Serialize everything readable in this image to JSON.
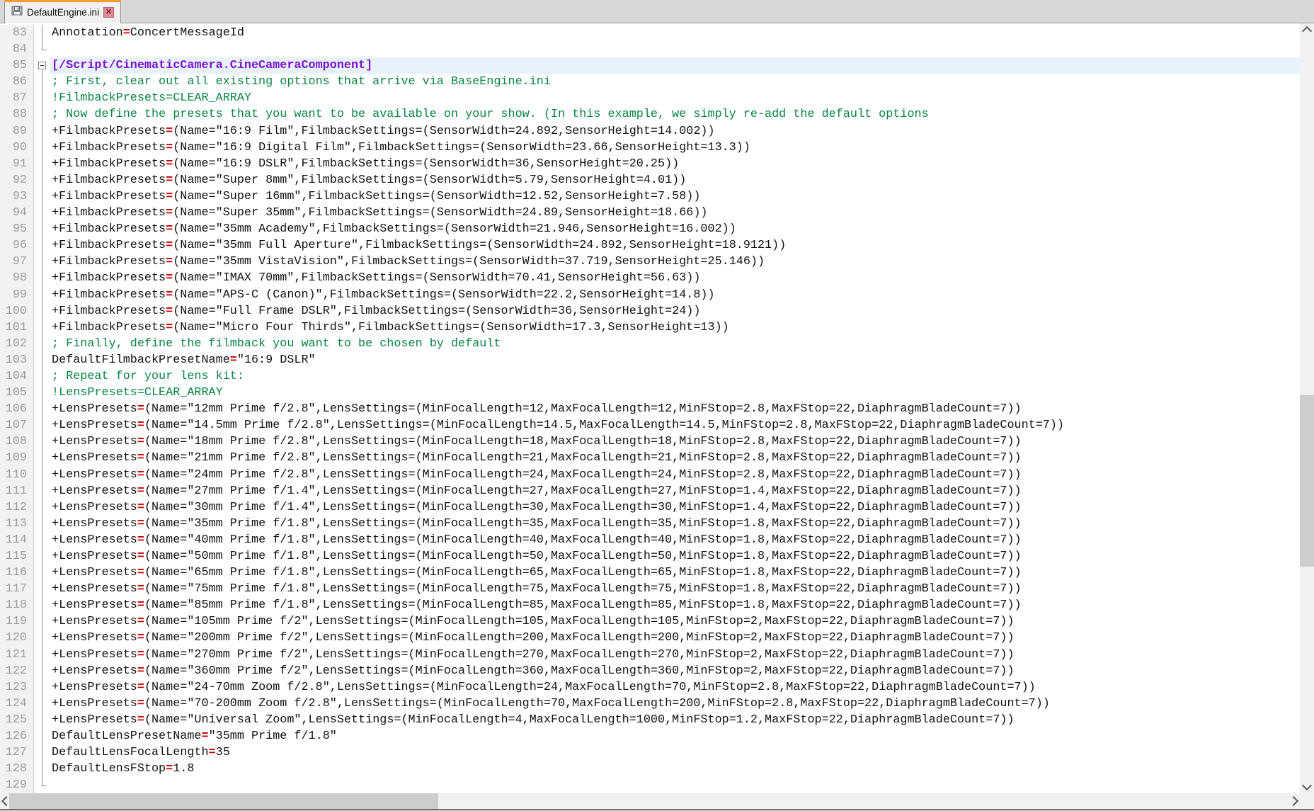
{
  "tab": {
    "title": "DefaultEngine.ini",
    "close_glyph": "✕",
    "save_icon": "floppy-disk-icon"
  },
  "editor": {
    "colors": {
      "text": "#121212",
      "assign": "#c40000",
      "comment": "#078542",
      "clearline": "#078542",
      "section": "#7a11d0",
      "linenum": "#9c9c9c",
      "currentline": "#e8f2fc"
    },
    "lines": [
      {
        "n": 83,
        "fold": "line",
        "type": "kv",
        "key": "Annotation",
        "eq": "=",
        "rest": "ConcertMessageId"
      },
      {
        "n": 84,
        "fold": "end",
        "type": "empty"
      },
      {
        "n": 85,
        "fold": "box",
        "type": "section",
        "current": true,
        "text": "[/Script/CinematicCamera.CineCameraComponent]"
      },
      {
        "n": 86,
        "fold": "line",
        "type": "comment",
        "text": "; First, clear out all existing options that arrive via BaseEngine.ini"
      },
      {
        "n": 87,
        "fold": "line",
        "type": "clear",
        "text": "!FilmbackPresets=CLEAR_ARRAY"
      },
      {
        "n": 88,
        "fold": "line",
        "type": "comment",
        "text": "; Now define the presets that you want to be available on your show. (In this example, we simply re-add the default options"
      },
      {
        "n": 89,
        "fold": "line",
        "type": "kv",
        "key": "+FilmbackPresets",
        "eq": "=",
        "rest": "(Name=\"16:9 Film\",FilmbackSettings=(SensorWidth=24.892,SensorHeight=14.002))"
      },
      {
        "n": 90,
        "fold": "line",
        "type": "kv",
        "key": "+FilmbackPresets",
        "eq": "=",
        "rest": "(Name=\"16:9 Digital Film\",FilmbackSettings=(SensorWidth=23.66,SensorHeight=13.3))"
      },
      {
        "n": 91,
        "fold": "line",
        "type": "kv",
        "key": "+FilmbackPresets",
        "eq": "=",
        "rest": "(Name=\"16:9 DSLR\",FilmbackSettings=(SensorWidth=36,SensorHeight=20.25))"
      },
      {
        "n": 92,
        "fold": "line",
        "type": "kv",
        "key": "+FilmbackPresets",
        "eq": "=",
        "rest": "(Name=\"Super 8mm\",FilmbackSettings=(SensorWidth=5.79,SensorHeight=4.01))"
      },
      {
        "n": 93,
        "fold": "line",
        "type": "kv",
        "key": "+FilmbackPresets",
        "eq": "=",
        "rest": "(Name=\"Super 16mm\",FilmbackSettings=(SensorWidth=12.52,SensorHeight=7.58))"
      },
      {
        "n": 94,
        "fold": "line",
        "type": "kv",
        "key": "+FilmbackPresets",
        "eq": "=",
        "rest": "(Name=\"Super 35mm\",FilmbackSettings=(SensorWidth=24.89,SensorHeight=18.66))"
      },
      {
        "n": 95,
        "fold": "line",
        "type": "kv",
        "key": "+FilmbackPresets",
        "eq": "=",
        "rest": "(Name=\"35mm Academy\",FilmbackSettings=(SensorWidth=21.946,SensorHeight=16.002))"
      },
      {
        "n": 96,
        "fold": "line",
        "type": "kv",
        "key": "+FilmbackPresets",
        "eq": "=",
        "rest": "(Name=\"35mm Full Aperture\",FilmbackSettings=(SensorWidth=24.892,SensorHeight=18.9121))"
      },
      {
        "n": 97,
        "fold": "line",
        "type": "kv",
        "key": "+FilmbackPresets",
        "eq": "=",
        "rest": "(Name=\"35mm VistaVision\",FilmbackSettings=(SensorWidth=37.719,SensorHeight=25.146))"
      },
      {
        "n": 98,
        "fold": "line",
        "type": "kv",
        "key": "+FilmbackPresets",
        "eq": "=",
        "rest": "(Name=\"IMAX 70mm\",FilmbackSettings=(SensorWidth=70.41,SensorHeight=56.63))"
      },
      {
        "n": 99,
        "fold": "line",
        "type": "kv",
        "key": "+FilmbackPresets",
        "eq": "=",
        "rest": "(Name=\"APS-C (Canon)\",FilmbackSettings=(SensorWidth=22.2,SensorHeight=14.8))"
      },
      {
        "n": 100,
        "fold": "line",
        "type": "kv",
        "key": "+FilmbackPresets",
        "eq": "=",
        "rest": "(Name=\"Full Frame DSLR\",FilmbackSettings=(SensorWidth=36,SensorHeight=24))"
      },
      {
        "n": 101,
        "fold": "line",
        "type": "kv",
        "key": "+FilmbackPresets",
        "eq": "=",
        "rest": "(Name=\"Micro Four Thirds\",FilmbackSettings=(SensorWidth=17.3,SensorHeight=13))"
      },
      {
        "n": 102,
        "fold": "line",
        "type": "comment",
        "text": "; Finally, define the filmback you want to be chosen by default"
      },
      {
        "n": 103,
        "fold": "line",
        "type": "kv",
        "key": "DefaultFilmbackPresetName",
        "eq": "=",
        "rest": "\"16:9 DSLR\""
      },
      {
        "n": 104,
        "fold": "line",
        "type": "comment",
        "text": "; Repeat for your lens kit:"
      },
      {
        "n": 105,
        "fold": "line",
        "type": "clear",
        "text": "!LensPresets=CLEAR_ARRAY"
      },
      {
        "n": 106,
        "fold": "line",
        "type": "kv",
        "key": "+LensPresets",
        "eq": "=",
        "rest": "(Name=\"12mm Prime f/2.8\",LensSettings=(MinFocalLength=12,MaxFocalLength=12,MinFStop=2.8,MaxFStop=22,DiaphragmBladeCount=7))"
      },
      {
        "n": 107,
        "fold": "line",
        "type": "kv",
        "key": "+LensPresets",
        "eq": "=",
        "rest": "(Name=\"14.5mm Prime f/2.8\",LensSettings=(MinFocalLength=14.5,MaxFocalLength=14.5,MinFStop=2.8,MaxFStop=22,DiaphragmBladeCount=7))"
      },
      {
        "n": 108,
        "fold": "line",
        "type": "kv",
        "key": "+LensPresets",
        "eq": "=",
        "rest": "(Name=\"18mm Prime f/2.8\",LensSettings=(MinFocalLength=18,MaxFocalLength=18,MinFStop=2.8,MaxFStop=22,DiaphragmBladeCount=7))"
      },
      {
        "n": 109,
        "fold": "line",
        "type": "kv",
        "key": "+LensPresets",
        "eq": "=",
        "rest": "(Name=\"21mm Prime f/2.8\",LensSettings=(MinFocalLength=21,MaxFocalLength=21,MinFStop=2.8,MaxFStop=22,DiaphragmBladeCount=7))"
      },
      {
        "n": 110,
        "fold": "line",
        "type": "kv",
        "key": "+LensPresets",
        "eq": "=",
        "rest": "(Name=\"24mm Prime f/2.8\",LensSettings=(MinFocalLength=24,MaxFocalLength=24,MinFStop=2.8,MaxFStop=22,DiaphragmBladeCount=7))"
      },
      {
        "n": 111,
        "fold": "line",
        "type": "kv",
        "key": "+LensPresets",
        "eq": "=",
        "rest": "(Name=\"27mm Prime f/1.4\",LensSettings=(MinFocalLength=27,MaxFocalLength=27,MinFStop=1.4,MaxFStop=22,DiaphragmBladeCount=7))"
      },
      {
        "n": 112,
        "fold": "line",
        "type": "kv",
        "key": "+LensPresets",
        "eq": "=",
        "rest": "(Name=\"30mm Prime f/1.4\",LensSettings=(MinFocalLength=30,MaxFocalLength=30,MinFStop=1.4,MaxFStop=22,DiaphragmBladeCount=7))"
      },
      {
        "n": 113,
        "fold": "line",
        "type": "kv",
        "key": "+LensPresets",
        "eq": "=",
        "rest": "(Name=\"35mm Prime f/1.8\",LensSettings=(MinFocalLength=35,MaxFocalLength=35,MinFStop=1.8,MaxFStop=22,DiaphragmBladeCount=7))"
      },
      {
        "n": 114,
        "fold": "line",
        "type": "kv",
        "key": "+LensPresets",
        "eq": "=",
        "rest": "(Name=\"40mm Prime f/1.8\",LensSettings=(MinFocalLength=40,MaxFocalLength=40,MinFStop=1.8,MaxFStop=22,DiaphragmBladeCount=7))"
      },
      {
        "n": 115,
        "fold": "line",
        "type": "kv",
        "key": "+LensPresets",
        "eq": "=",
        "rest": "(Name=\"50mm Prime f/1.8\",LensSettings=(MinFocalLength=50,MaxFocalLength=50,MinFStop=1.8,MaxFStop=22,DiaphragmBladeCount=7))"
      },
      {
        "n": 116,
        "fold": "line",
        "type": "kv",
        "key": "+LensPresets",
        "eq": "=",
        "rest": "(Name=\"65mm Prime f/1.8\",LensSettings=(MinFocalLength=65,MaxFocalLength=65,MinFStop=1.8,MaxFStop=22,DiaphragmBladeCount=7))"
      },
      {
        "n": 117,
        "fold": "line",
        "type": "kv",
        "key": "+LensPresets",
        "eq": "=",
        "rest": "(Name=\"75mm Prime f/1.8\",LensSettings=(MinFocalLength=75,MaxFocalLength=75,MinFStop=1.8,MaxFStop=22,DiaphragmBladeCount=7))"
      },
      {
        "n": 118,
        "fold": "line",
        "type": "kv",
        "key": "+LensPresets",
        "eq": "=",
        "rest": "(Name=\"85mm Prime f/1.8\",LensSettings=(MinFocalLength=85,MaxFocalLength=85,MinFStop=1.8,MaxFStop=22,DiaphragmBladeCount=7))"
      },
      {
        "n": 119,
        "fold": "line",
        "type": "kv",
        "key": "+LensPresets",
        "eq": "=",
        "rest": "(Name=\"105mm Prime f/2\",LensSettings=(MinFocalLength=105,MaxFocalLength=105,MinFStop=2,MaxFStop=22,DiaphragmBladeCount=7))"
      },
      {
        "n": 120,
        "fold": "line",
        "type": "kv",
        "key": "+LensPresets",
        "eq": "=",
        "rest": "(Name=\"200mm Prime f/2\",LensSettings=(MinFocalLength=200,MaxFocalLength=200,MinFStop=2,MaxFStop=22,DiaphragmBladeCount=7))"
      },
      {
        "n": 121,
        "fold": "line",
        "type": "kv",
        "key": "+LensPresets",
        "eq": "=",
        "rest": "(Name=\"270mm Prime f/2\",LensSettings=(MinFocalLength=270,MaxFocalLength=270,MinFStop=2,MaxFStop=22,DiaphragmBladeCount=7))"
      },
      {
        "n": 122,
        "fold": "line",
        "type": "kv",
        "key": "+LensPresets",
        "eq": "=",
        "rest": "(Name=\"360mm Prime f/2\",LensSettings=(MinFocalLength=360,MaxFocalLength=360,MinFStop=2,MaxFStop=22,DiaphragmBladeCount=7))"
      },
      {
        "n": 123,
        "fold": "line",
        "type": "kv",
        "key": "+LensPresets",
        "eq": "=",
        "rest": "(Name=\"24-70mm Zoom f/2.8\",LensSettings=(MinFocalLength=24,MaxFocalLength=70,MinFStop=2.8,MaxFStop=22,DiaphragmBladeCount=7))"
      },
      {
        "n": 124,
        "fold": "line",
        "type": "kv",
        "key": "+LensPresets",
        "eq": "=",
        "rest": "(Name=\"70-200mm Zoom f/2.8\",LensSettings=(MinFocalLength=70,MaxFocalLength=200,MinFStop=2.8,MaxFStop=22,DiaphragmBladeCount=7))"
      },
      {
        "n": 125,
        "fold": "line",
        "type": "kv",
        "key": "+LensPresets",
        "eq": "=",
        "rest": "(Name=\"Universal Zoom\",LensSettings=(MinFocalLength=4,MaxFocalLength=1000,MinFStop=1.2,MaxFStop=22,DiaphragmBladeCount=7))"
      },
      {
        "n": 126,
        "fold": "line",
        "type": "kv",
        "key": "DefaultLensPresetName",
        "eq": "=",
        "rest": "\"35mm Prime f/1.8\""
      },
      {
        "n": 127,
        "fold": "line",
        "type": "kv",
        "key": "DefaultLensFocalLength",
        "eq": "=",
        "rest": "35"
      },
      {
        "n": 128,
        "fold": "line",
        "type": "kv",
        "key": "DefaultLensFStop",
        "eq": "=",
        "rest": "1.8"
      },
      {
        "n": 129,
        "fold": "end",
        "type": "empty"
      }
    ]
  }
}
